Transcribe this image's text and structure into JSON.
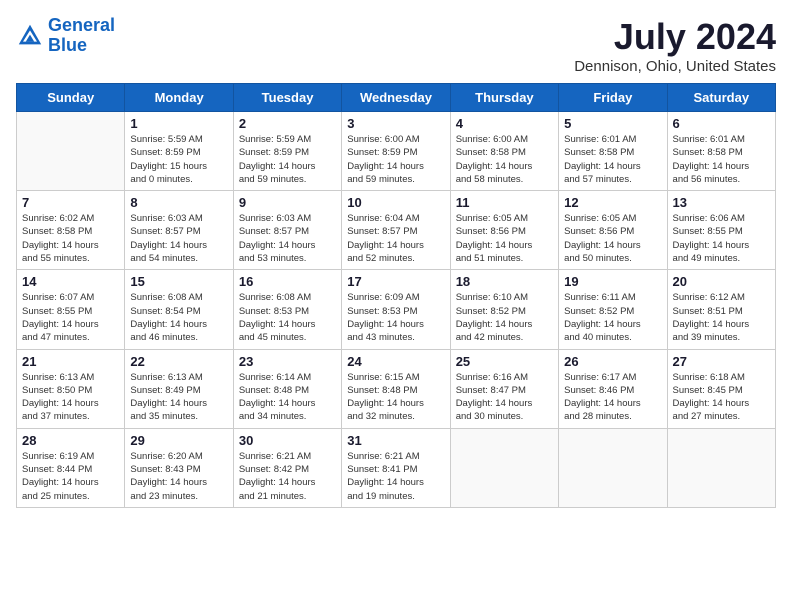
{
  "header": {
    "logo_line1": "General",
    "logo_line2": "Blue",
    "title": "July 2024",
    "subtitle": "Dennison, Ohio, United States"
  },
  "days_of_week": [
    "Sunday",
    "Monday",
    "Tuesday",
    "Wednesday",
    "Thursday",
    "Friday",
    "Saturday"
  ],
  "weeks": [
    [
      {
        "day": "",
        "info": ""
      },
      {
        "day": "1",
        "info": "Sunrise: 5:59 AM\nSunset: 8:59 PM\nDaylight: 15 hours\nand 0 minutes."
      },
      {
        "day": "2",
        "info": "Sunrise: 5:59 AM\nSunset: 8:59 PM\nDaylight: 14 hours\nand 59 minutes."
      },
      {
        "day": "3",
        "info": "Sunrise: 6:00 AM\nSunset: 8:59 PM\nDaylight: 14 hours\nand 59 minutes."
      },
      {
        "day": "4",
        "info": "Sunrise: 6:00 AM\nSunset: 8:58 PM\nDaylight: 14 hours\nand 58 minutes."
      },
      {
        "day": "5",
        "info": "Sunrise: 6:01 AM\nSunset: 8:58 PM\nDaylight: 14 hours\nand 57 minutes."
      },
      {
        "day": "6",
        "info": "Sunrise: 6:01 AM\nSunset: 8:58 PM\nDaylight: 14 hours\nand 56 minutes."
      }
    ],
    [
      {
        "day": "7",
        "info": "Sunrise: 6:02 AM\nSunset: 8:58 PM\nDaylight: 14 hours\nand 55 minutes."
      },
      {
        "day": "8",
        "info": "Sunrise: 6:03 AM\nSunset: 8:57 PM\nDaylight: 14 hours\nand 54 minutes."
      },
      {
        "day": "9",
        "info": "Sunrise: 6:03 AM\nSunset: 8:57 PM\nDaylight: 14 hours\nand 53 minutes."
      },
      {
        "day": "10",
        "info": "Sunrise: 6:04 AM\nSunset: 8:57 PM\nDaylight: 14 hours\nand 52 minutes."
      },
      {
        "day": "11",
        "info": "Sunrise: 6:05 AM\nSunset: 8:56 PM\nDaylight: 14 hours\nand 51 minutes."
      },
      {
        "day": "12",
        "info": "Sunrise: 6:05 AM\nSunset: 8:56 PM\nDaylight: 14 hours\nand 50 minutes."
      },
      {
        "day": "13",
        "info": "Sunrise: 6:06 AM\nSunset: 8:55 PM\nDaylight: 14 hours\nand 49 minutes."
      }
    ],
    [
      {
        "day": "14",
        "info": "Sunrise: 6:07 AM\nSunset: 8:55 PM\nDaylight: 14 hours\nand 47 minutes."
      },
      {
        "day": "15",
        "info": "Sunrise: 6:08 AM\nSunset: 8:54 PM\nDaylight: 14 hours\nand 46 minutes."
      },
      {
        "day": "16",
        "info": "Sunrise: 6:08 AM\nSunset: 8:53 PM\nDaylight: 14 hours\nand 45 minutes."
      },
      {
        "day": "17",
        "info": "Sunrise: 6:09 AM\nSunset: 8:53 PM\nDaylight: 14 hours\nand 43 minutes."
      },
      {
        "day": "18",
        "info": "Sunrise: 6:10 AM\nSunset: 8:52 PM\nDaylight: 14 hours\nand 42 minutes."
      },
      {
        "day": "19",
        "info": "Sunrise: 6:11 AM\nSunset: 8:52 PM\nDaylight: 14 hours\nand 40 minutes."
      },
      {
        "day": "20",
        "info": "Sunrise: 6:12 AM\nSunset: 8:51 PM\nDaylight: 14 hours\nand 39 minutes."
      }
    ],
    [
      {
        "day": "21",
        "info": "Sunrise: 6:13 AM\nSunset: 8:50 PM\nDaylight: 14 hours\nand 37 minutes."
      },
      {
        "day": "22",
        "info": "Sunrise: 6:13 AM\nSunset: 8:49 PM\nDaylight: 14 hours\nand 35 minutes."
      },
      {
        "day": "23",
        "info": "Sunrise: 6:14 AM\nSunset: 8:48 PM\nDaylight: 14 hours\nand 34 minutes."
      },
      {
        "day": "24",
        "info": "Sunrise: 6:15 AM\nSunset: 8:48 PM\nDaylight: 14 hours\nand 32 minutes."
      },
      {
        "day": "25",
        "info": "Sunrise: 6:16 AM\nSunset: 8:47 PM\nDaylight: 14 hours\nand 30 minutes."
      },
      {
        "day": "26",
        "info": "Sunrise: 6:17 AM\nSunset: 8:46 PM\nDaylight: 14 hours\nand 28 minutes."
      },
      {
        "day": "27",
        "info": "Sunrise: 6:18 AM\nSunset: 8:45 PM\nDaylight: 14 hours\nand 27 minutes."
      }
    ],
    [
      {
        "day": "28",
        "info": "Sunrise: 6:19 AM\nSunset: 8:44 PM\nDaylight: 14 hours\nand 25 minutes."
      },
      {
        "day": "29",
        "info": "Sunrise: 6:20 AM\nSunset: 8:43 PM\nDaylight: 14 hours\nand 23 minutes."
      },
      {
        "day": "30",
        "info": "Sunrise: 6:21 AM\nSunset: 8:42 PM\nDaylight: 14 hours\nand 21 minutes."
      },
      {
        "day": "31",
        "info": "Sunrise: 6:21 AM\nSunset: 8:41 PM\nDaylight: 14 hours\nand 19 minutes."
      },
      {
        "day": "",
        "info": ""
      },
      {
        "day": "",
        "info": ""
      },
      {
        "day": "",
        "info": ""
      }
    ]
  ]
}
